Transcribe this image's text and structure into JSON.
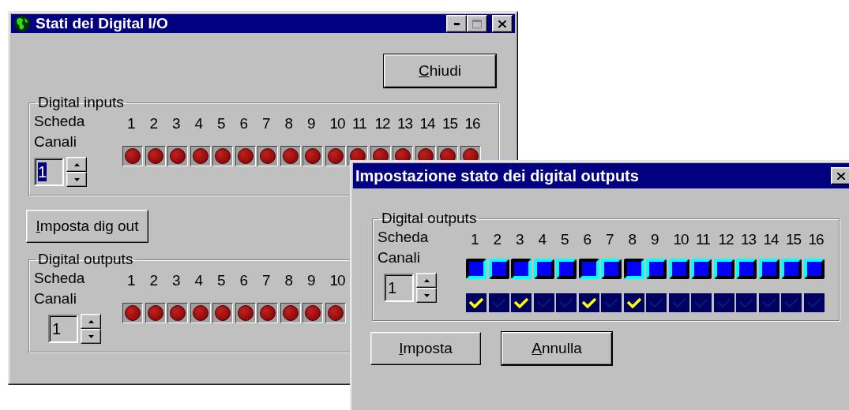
{
  "windows": [
    {
      "kind": "io_status",
      "title": "Stati dei Digital I/O",
      "close_label": "Chiudi",
      "set_label": "Imposta dig out",
      "groups": [
        {
          "legend": "Digital inputs",
          "board_label": "Scheda",
          "channels_label": "Canali",
          "board": "1",
          "board_selected": true,
          "channels": [
            {
              "label": "1",
              "on": false
            },
            {
              "label": "2",
              "on": false
            },
            {
              "label": "3",
              "on": false
            },
            {
              "label": "4",
              "on": false
            },
            {
              "label": "5",
              "on": false
            },
            {
              "label": "6",
              "on": false
            },
            {
              "label": "7",
              "on": false
            },
            {
              "label": "8",
              "on": false
            },
            {
              "label": "9",
              "on": false
            },
            {
              "label": "10",
              "on": false
            },
            {
              "label": "11",
              "on": false
            },
            {
              "label": "12",
              "on": false
            },
            {
              "label": "13",
              "on": false
            },
            {
              "label": "14",
              "on": false
            },
            {
              "label": "15",
              "on": false
            },
            {
              "label": "16",
              "on": false
            }
          ]
        },
        {
          "legend": "Digital outputs",
          "board_label": "Scheda",
          "channels_label": "Canali",
          "board": "1",
          "board_selected": false,
          "channels": [
            {
              "label": "1",
              "on": false
            },
            {
              "label": "2",
              "on": false
            },
            {
              "label": "3",
              "on": false
            },
            {
              "label": "4",
              "on": false
            },
            {
              "label": "5",
              "on": false
            },
            {
              "label": "6",
              "on": false
            },
            {
              "label": "7",
              "on": false
            },
            {
              "label": "8",
              "on": false
            },
            {
              "label": "9",
              "on": false
            },
            {
              "label": "10",
              "on": false
            }
          ]
        }
      ]
    },
    {
      "kind": "set_outputs",
      "title": "Impostazione stato dei digital outputs",
      "group": {
        "legend": "Digital outputs",
        "board_label": "Scheda",
        "channels_label": "Canali",
        "board": "1",
        "channels": [
          {
            "label": "1",
            "on": true,
            "checked": true
          },
          {
            "label": "2",
            "on": false,
            "checked": false
          },
          {
            "label": "3",
            "on": true,
            "checked": true
          },
          {
            "label": "4",
            "on": false,
            "checked": false
          },
          {
            "label": "5",
            "on": false,
            "checked": false
          },
          {
            "label": "6",
            "on": true,
            "checked": true
          },
          {
            "label": "7",
            "on": false,
            "checked": false
          },
          {
            "label": "8",
            "on": true,
            "checked": true
          },
          {
            "label": "9",
            "on": false,
            "checked": false
          },
          {
            "label": "10",
            "on": false,
            "checked": false
          },
          {
            "label": "11",
            "on": false,
            "checked": false
          },
          {
            "label": "12",
            "on": false,
            "checked": false
          },
          {
            "label": "13",
            "on": false,
            "checked": false
          },
          {
            "label": "14",
            "on": false,
            "checked": false
          },
          {
            "label": "15",
            "on": false,
            "checked": false
          },
          {
            "label": "16",
            "on": false,
            "checked": false
          }
        ]
      },
      "buttons": [
        "Imposta",
        "Annulla"
      ]
    }
  ]
}
